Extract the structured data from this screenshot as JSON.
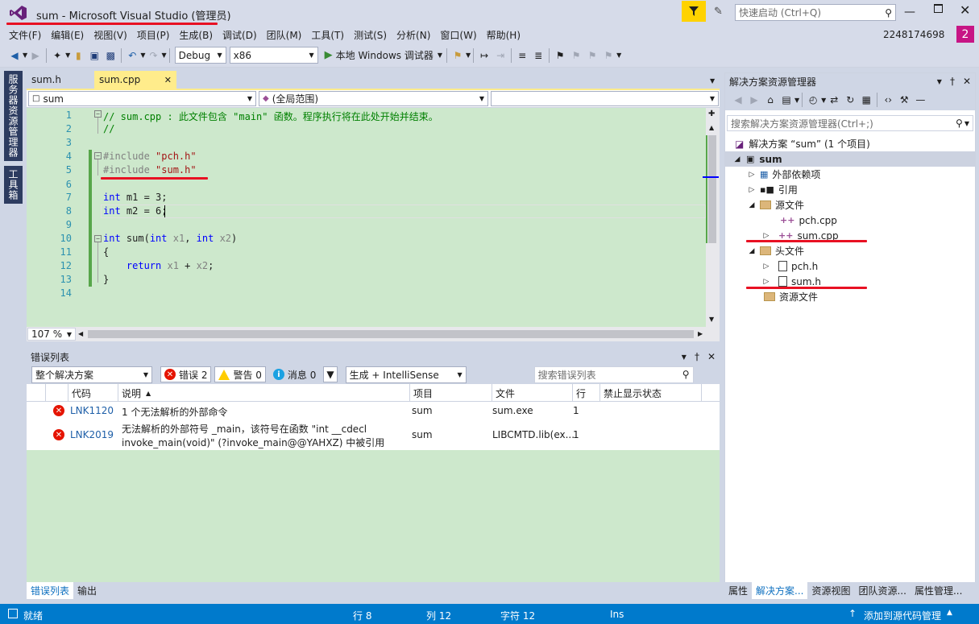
{
  "window": {
    "title": "sum - Microsoft Visual Studio (管理员)",
    "quick_launch_placeholder": "快速启动 (Ctrl+Q)",
    "user": "2248174698",
    "notification_count": "2"
  },
  "menu": [
    "文件(F)",
    "编辑(E)",
    "视图(V)",
    "项目(P)",
    "生成(B)",
    "调试(D)",
    "团队(M)",
    "工具(T)",
    "测试(S)",
    "分析(N)",
    "窗口(W)",
    "帮助(H)"
  ],
  "toolbar": {
    "config": "Debug",
    "platform": "x86",
    "run_label": "本地 Windows 调试器"
  },
  "left_tabs": [
    "服务器资源管理器",
    "工具箱"
  ],
  "doc_tabs": [
    {
      "label": "sum.h",
      "active": false
    },
    {
      "label": "sum.cpp",
      "active": true
    }
  ],
  "navbar": {
    "project": "sum",
    "scope": "(全局范围)",
    "member": ""
  },
  "editor": {
    "lines": [
      {
        "n": "1",
        "html": "<span class='cm'>// sum.cpp : 此文件包含 \"main\" 函数。程序执行将在此处开始并结束。</span>"
      },
      {
        "n": "2",
        "html": "<span class='cm'>//</span>"
      },
      {
        "n": "3",
        "html": ""
      },
      {
        "n": "4",
        "html": "<span class='pp'>#include</span> <span class='st'>\"pch.h\"</span>"
      },
      {
        "n": "5",
        "html": "<span class='pp'>#include</span> <span class='st'>\"sum.h\"</span>"
      },
      {
        "n": "6",
        "html": ""
      },
      {
        "n": "7",
        "html": "<span class='kw'>int</span> m1 = 3;"
      },
      {
        "n": "8",
        "html": "<span class='kw'>int</span> m2 = 6;"
      },
      {
        "n": "9",
        "html": ""
      },
      {
        "n": "10",
        "html": "<span class='kw'>int</span> sum(<span class='kw'>int</span> <span class='pm'>x1</span>, <span class='kw'>int</span> <span class='pm'>x2</span>)"
      },
      {
        "n": "11",
        "html": "{"
      },
      {
        "n": "12",
        "html": "    <span class='kw'>return</span> <span class='pm'>x1</span> + <span class='pm'>x2</span>;"
      },
      {
        "n": "13",
        "html": "}"
      },
      {
        "n": "14",
        "html": ""
      }
    ],
    "zoom": "107 %"
  },
  "error_list": {
    "title": "错误列表",
    "scope": "整个解决方案",
    "errors_label": "错误 2",
    "warnings_label": "警告 0",
    "messages_label": "消息 0",
    "source_filter": "生成 + IntelliSense",
    "search_placeholder": "搜索错误列表",
    "columns": [
      "代码",
      "说明",
      "项目",
      "文件",
      "行",
      "禁止显示状态"
    ],
    "rows": [
      {
        "code": "LNK1120",
        "desc1": "1 个无法解析的外部命令",
        "desc2": "",
        "project": "sum",
        "file": "sum.exe",
        "line": "1"
      },
      {
        "code": "LNK2019",
        "desc1": "无法解析的外部符号 _main，该符号在函数 \"int __cdecl",
        "desc2": "invoke_main(void)\" (?invoke_main@@YAHXZ) 中被引用",
        "project": "sum",
        "file": "LIBCMTD.lib(ex...",
        "line": "1"
      }
    ]
  },
  "bottom_tabs": [
    "错误列表",
    "输出"
  ],
  "solution_explorer": {
    "title": "解决方案资源管理器",
    "search_placeholder": "搜索解决方案资源管理器(Ctrl+;)",
    "solution": "解决方案 “sum” (1 个项目)",
    "project": "sum",
    "nodes": [
      "外部依赖项",
      "引用",
      "源文件",
      "pch.cpp",
      "sum.cpp",
      "头文件",
      "pch.h",
      "sum.h",
      "资源文件"
    ]
  },
  "sol_tabs": [
    "属性",
    "解决方案...",
    "资源视图",
    "团队资源...",
    "属性管理..."
  ],
  "status": {
    "ready": "就绪",
    "line": "行 8",
    "col": "列 12",
    "char": "字符 12",
    "mode": "Ins",
    "source_control": "添加到源代码管理"
  },
  "colors": {
    "accent": "#007acc",
    "vs_purple": "#68217a",
    "error_red": "#e51400",
    "annotation_red": "#e81123"
  }
}
